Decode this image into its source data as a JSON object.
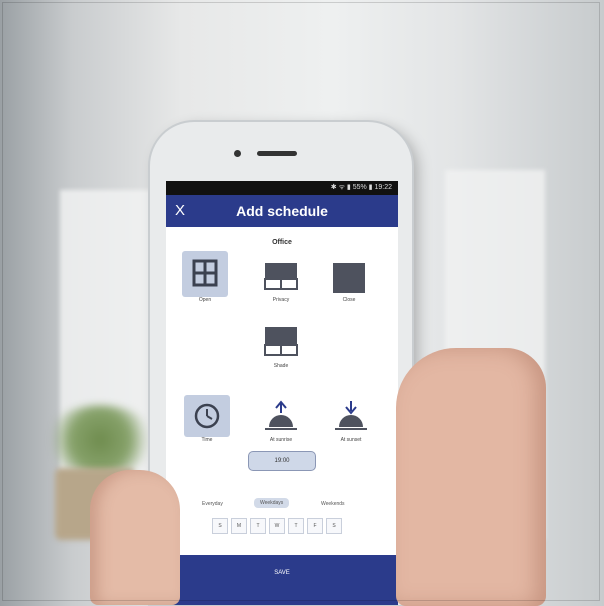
{
  "status": {
    "text": "✱ ᯤ ▮ 55% ▮ 19:22"
  },
  "header": {
    "close": "X",
    "title": "Add schedule"
  },
  "room": "Office",
  "positions": [
    {
      "label": "Open"
    },
    {
      "label": "Privacy"
    },
    {
      "label": "Close"
    },
    {
      "label": "Shade"
    }
  ],
  "triggers": [
    {
      "label": "Time"
    },
    {
      "label": "At sunrise"
    },
    {
      "label": "At sunset"
    }
  ],
  "time_value": "19:00",
  "repeat": [
    {
      "label": "Everyday"
    },
    {
      "label": "Weekdays"
    },
    {
      "label": "Weekends"
    }
  ],
  "days": [
    "S",
    "M",
    "T",
    "W",
    "T",
    "F",
    "S"
  ],
  "save": "SAVE",
  "colors": {
    "accent": "#2b3b8b",
    "selected": "#c3cde0"
  }
}
